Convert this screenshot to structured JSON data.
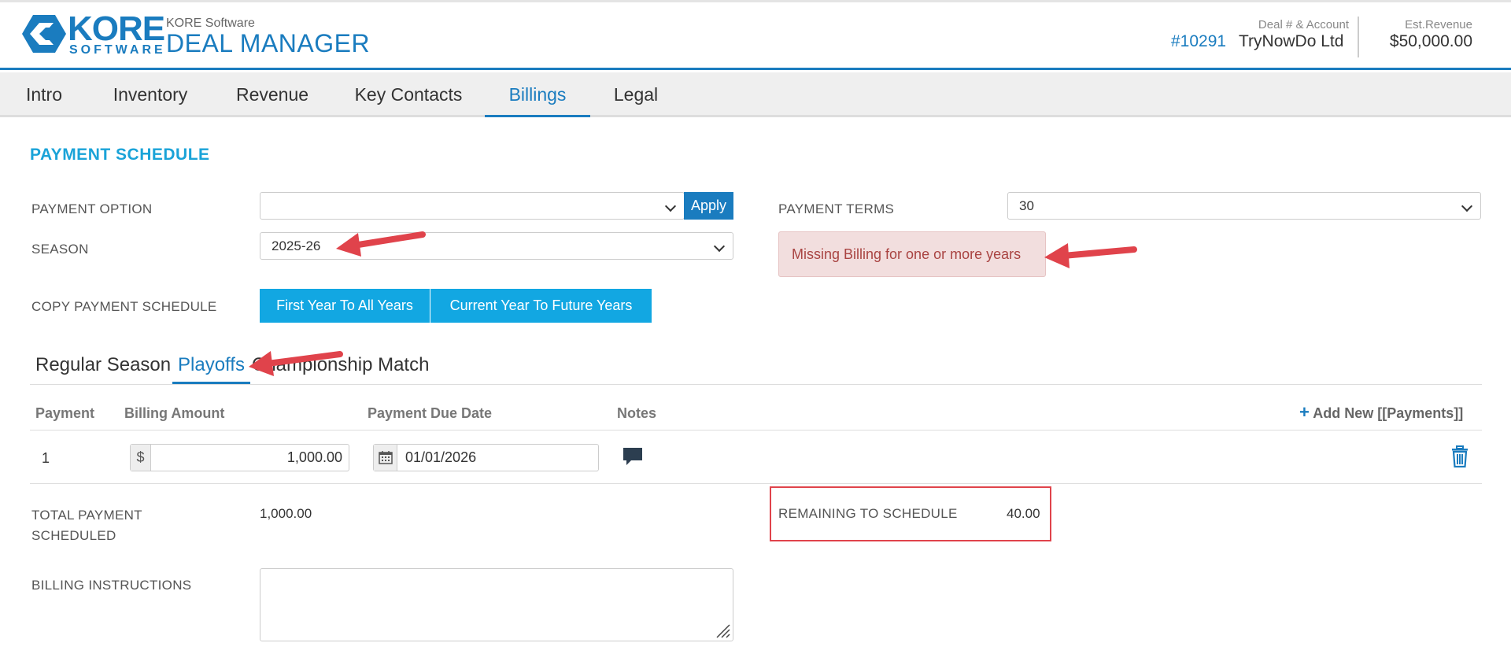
{
  "header": {
    "logo_word": "KORE",
    "logo_sub": "SOFTWARE",
    "app_sub": "KORE Software",
    "app_title": "DEAL MANAGER",
    "deal_label": "Deal # & Account",
    "deal_number": "#10291",
    "account": "TryNowDo Ltd",
    "revenue_label": "Est.Revenue",
    "revenue_value": "$50,000.00"
  },
  "nav": {
    "items": [
      {
        "label": "Intro"
      },
      {
        "label": "Inventory"
      },
      {
        "label": "Revenue"
      },
      {
        "label": "Key Contacts"
      },
      {
        "label": "Billings"
      },
      {
        "label": "Legal"
      }
    ],
    "active": "Billings"
  },
  "payment": {
    "section_title": "PAYMENT SCHEDULE",
    "option_label": "PAYMENT OPTION",
    "option_value": "",
    "apply_label": "Apply",
    "terms_label": "PAYMENT TERMS",
    "terms_value": "30",
    "season_label": "SEASON",
    "season_value": "2025-26",
    "alert_text": "Missing Billing for one or more years",
    "copy_label": "COPY PAYMENT SCHEDULE",
    "copy_first": "First Year To All Years",
    "copy_current": "Current Year To Future Years"
  },
  "subtabs": {
    "items": [
      {
        "label": "Regular Season"
      },
      {
        "label": "Playoffs"
      },
      {
        "label": "Championship Match"
      }
    ],
    "active": "Playoffs"
  },
  "table": {
    "headers": {
      "payment": "Payment",
      "amount": "Billing Amount",
      "due_date": "Payment Due Date",
      "notes": "Notes",
      "add_new": "Add New [[Payments]]"
    },
    "rows": [
      {
        "payment": "1",
        "currency": "$",
        "amount": "1,000.00",
        "due_date": "01/01/2026"
      }
    ]
  },
  "totals": {
    "total_label_1": "TOTAL PAYMENT",
    "total_label_2": "SCHEDULED",
    "total_value": "1,000.00",
    "remaining_label": "REMAINING TO SCHEDULE",
    "remaining_value": "40.00"
  },
  "billing": {
    "instructions_label": "BILLING INSTRUCTIONS",
    "instructions_value": ""
  },
  "colors": {
    "brand_blue": "#1a7cbf",
    "button_blue": "#12a7e2",
    "alert_bg": "#f2dede",
    "alert_text": "#a94442",
    "annotation_red": "#e0434b"
  }
}
